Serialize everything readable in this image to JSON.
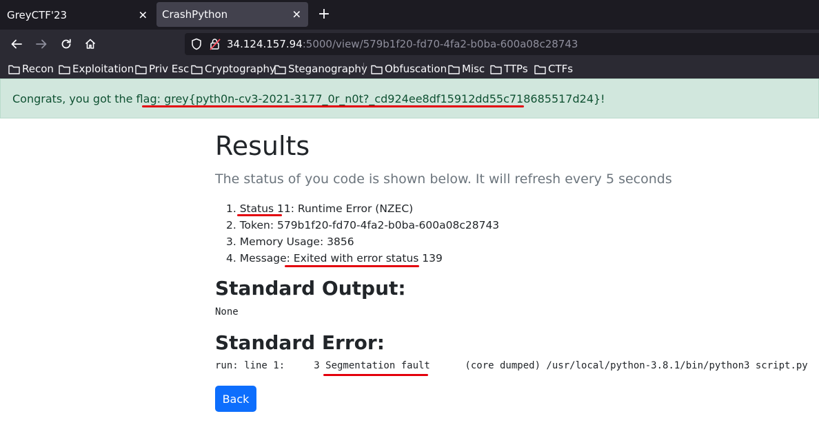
{
  "browser": {
    "tabs": [
      {
        "label": "GreyCTF'23",
        "close": "✕"
      },
      {
        "label": "CrashPython",
        "close": "✕"
      }
    ],
    "new_tab": "+",
    "url": {
      "host": "34.124.157.94",
      "path": ":5000/view/579b1f20-fd70-4fa2-b0ba-600a08c28743"
    },
    "bookmarks": [
      "Recon",
      "Exploitation",
      "Priv Esc",
      "Cryptography",
      "Steganography",
      "Obfuscation",
      "Misc",
      "TTPs",
      "CTFs"
    ]
  },
  "alert": {
    "text": "Congrats, you got the flag: grey{pyth0n-cv3-2021-3177_0r_n0t?_cd924ee8df15912dd55c718685517d24}!"
  },
  "results": {
    "title": "Results",
    "lead": "The status of you code is shown below. It will refresh every 5 seconds",
    "items": [
      "1. Status 11: Runtime Error (NZEC)",
      "2. Token: 579b1f20-fd70-4fa2-b0ba-600a08c28743",
      "3. Memory Usage: 3856",
      "4. Message: Exited with error status 139"
    ],
    "stdout_heading": "Standard Output:",
    "stdout": "None",
    "stderr_heading": "Standard Error:",
    "stderr": "run: line 1:     3 Segmentation fault      (core dumped) /usr/local/python-3.8.1/bin/python3 script.py",
    "back_label": "Back"
  },
  "colors": {
    "alert_bg": "#d1e7dd",
    "alert_text": "#0f5132",
    "annotation_red": "#e3000b",
    "button_blue": "#0d6efd"
  }
}
